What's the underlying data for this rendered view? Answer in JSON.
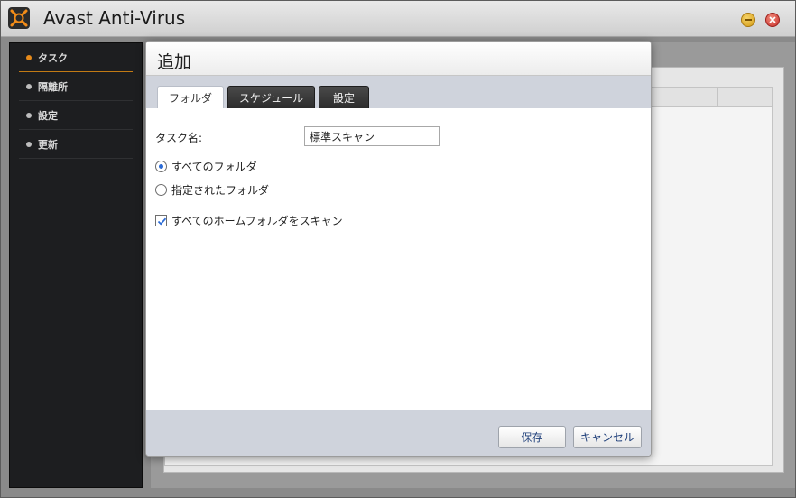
{
  "window": {
    "title": "Avast Anti-Virus"
  },
  "sidebar": {
    "items": [
      {
        "label": "タスク",
        "active": true
      },
      {
        "label": "隔離所",
        "active": false
      },
      {
        "label": "設定",
        "active": false
      },
      {
        "label": "更新",
        "active": false
      }
    ]
  },
  "dialog": {
    "title": "追加",
    "tabs": [
      {
        "label": "フォルダ",
        "active": true
      },
      {
        "label": "スケジュール",
        "active": false
      },
      {
        "label": "設定",
        "active": false
      }
    ],
    "task_name": {
      "label": "タスク名:",
      "value": "標準スキャン"
    },
    "folder_options": [
      {
        "label": "すべてのフォルダ",
        "checked": true
      },
      {
        "label": "指定されたフォルダ",
        "checked": false
      }
    ],
    "scan_home": {
      "label": "すべてのホームフォルダをスキャン",
      "checked": true
    },
    "buttons": {
      "save": "保存",
      "cancel": "キャンセル"
    }
  },
  "colors": {
    "accent": "#e68a1a",
    "radio_selected": "#2b6bd6",
    "footer": "#cfd3dc"
  },
  "icons": {
    "logo": "avast-logo-icon",
    "minimize": "minimize-icon",
    "close": "close-icon"
  }
}
